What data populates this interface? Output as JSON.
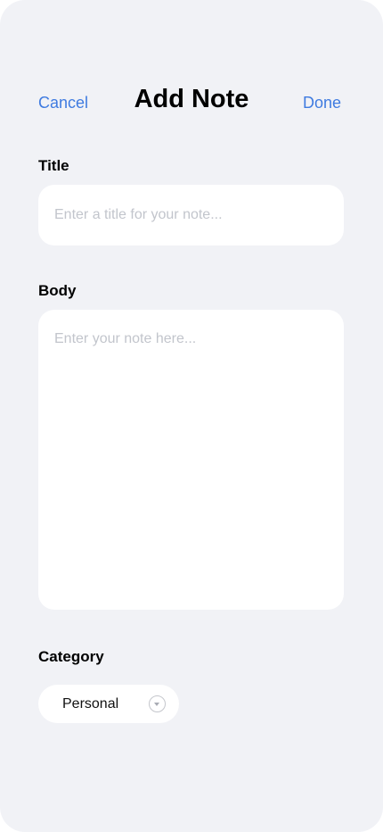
{
  "header": {
    "cancel_label": "Cancel",
    "title": "Add Note",
    "done_label": "Done"
  },
  "form": {
    "title_label": "Title",
    "title_value": "",
    "title_placeholder": "Enter a title for your note...",
    "body_label": "Body",
    "body_value": "",
    "body_placeholder": "Enter your note here...",
    "category_label": "Category",
    "category_value": "Personal"
  },
  "colors": {
    "accent": "#3f7be0",
    "background": "#f1f2f6",
    "field_background": "#ffffff",
    "placeholder": "#c2c5cc"
  },
  "icons": {
    "category_dropdown": "chevron-down-circle-icon"
  }
}
